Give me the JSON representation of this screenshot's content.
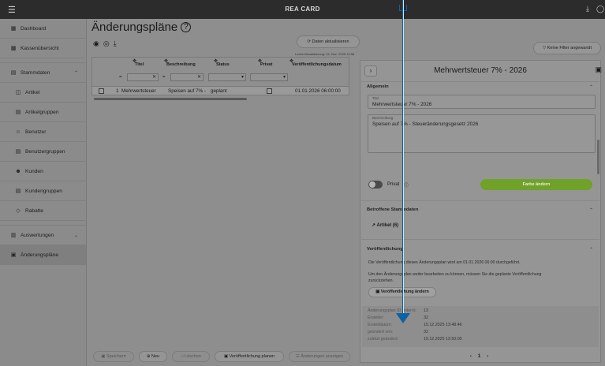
{
  "topbar": {
    "menu_icon": "hamburger-icon",
    "brand": "REA CARD",
    "download_icon": "download-icon",
    "user_icon": "user-circle-icon"
  },
  "sidebar": {
    "items": [
      {
        "icon": "dashboard-icon",
        "label": "Dashboard"
      },
      {
        "icon": "cash-register-icon",
        "label": "Kassenübersicht"
      },
      {
        "icon": "master-data-icon",
        "label": "Stammdaten"
      },
      {
        "icon": "article-icon",
        "label": "Artikel"
      },
      {
        "icon": "article-group-icon",
        "label": "Artikelgruppen"
      },
      {
        "icon": "user-icon",
        "label": "Benutzer"
      },
      {
        "icon": "user-group-icon",
        "label": "Benutzergruppen"
      },
      {
        "icon": "customers-icon",
        "label": "Kunden"
      },
      {
        "icon": "customer-group-icon",
        "label": "Kundengruppen"
      },
      {
        "icon": "tag-icon",
        "label": "Rabatte"
      },
      {
        "icon": "chart-icon",
        "label": "Auswertungen"
      },
      {
        "icon": "calendar-icon",
        "label": "Änderungspläne"
      }
    ]
  },
  "page": {
    "title": "Änderungspläne",
    "refresh_label": "Daten aktualisieren",
    "last_update": "Letzte Aktualisierung: 15. Dez. 2025 13:58",
    "filter_label": "Keine Filter angewandt"
  },
  "grid": {
    "columns": [
      "Titel",
      "Beschreibung",
      "Status",
      "Privat",
      "Veröffentlichungsdatum"
    ],
    "filter_ops": [
      "=",
      "="
    ],
    "filter_clear": [
      "✕",
      "✕"
    ],
    "select_caret": [
      "▾",
      "▾"
    ],
    "row": {
      "index": "1",
      "title": "Mehrwertsteuer",
      "description": "Speisen auf 7% -",
      "status": "geplant",
      "published": "01.01.2026 06:00:00"
    }
  },
  "panel": {
    "title": "Mehrwertsteuer 7% - 2026",
    "section_general": "Allgemein",
    "title_label": "Titel",
    "title_value": "Mehrwertsteuer 7% - 2026",
    "desc_label": "Beschreibung",
    "desc_value": "Speisen auf 7% - Steueränderungsgesetz 2026",
    "private_label": "Privat",
    "color_button": "Farbe ändern",
    "section_masterdata": "Betroffene Stammdaten",
    "articles_link": "Artikel (6)",
    "section_publish": "Veröffentlichung",
    "publish_text_1": "Die Veröffentlichung dieses Änderungsplan wird am 01.01.2026 06:00 durchgeführt.",
    "publish_text_2": "Um den Änderungsplan weiter bearbeiten zu können, müssen Sie die geplante Veröffentlichung",
    "publish_text_3": "zurückziehen.",
    "publish_button": "Veröffentlichung ändern",
    "meta": [
      {
        "key": "Änderungsplan ID (intern):",
        "value": "13"
      },
      {
        "key": "Ersteller:",
        "value": "32"
      },
      {
        "key": "Erstelldatum:",
        "value": "15.12.2025 13:48:46"
      },
      {
        "key": "geändert von:",
        "value": "32"
      },
      {
        "key": "zuletzt geändert:",
        "value": "15.12.2025 13:50:00"
      }
    ],
    "page_current": "1",
    "page_prev": "‹",
    "page_next": "›"
  },
  "bottom": {
    "save": "Speichern",
    "new": "Neu",
    "delete": "Löschen",
    "plan_publish": "Veröffentlichung planen",
    "show_changes": "Änderungen anzeigen"
  }
}
